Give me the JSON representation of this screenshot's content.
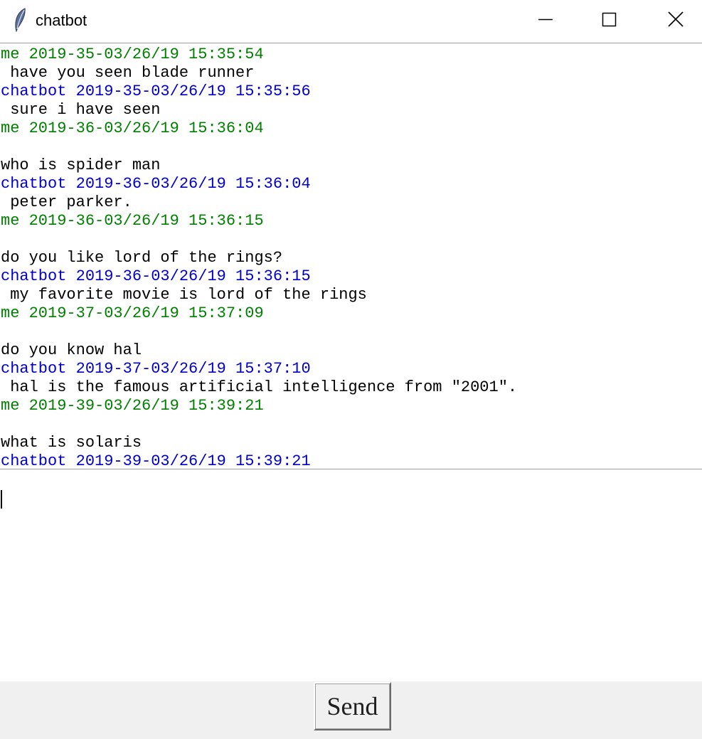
{
  "window": {
    "title": "chatbot",
    "app_icon": "feather-icon",
    "controls": {
      "minimize": "minimize-icon",
      "maximize": "maximize-icon",
      "close": "close-icon"
    }
  },
  "colors": {
    "me": "#008000",
    "chatbot": "#0000cc",
    "text": "#000000",
    "bottom_bar": "#f0f0f0"
  },
  "chat_log": [
    {
      "kind": "me",
      "text": "me 2019-35-03/26/19 15:35:54"
    },
    {
      "kind": "text",
      "text": " have you seen blade runner"
    },
    {
      "kind": "bot",
      "text": "chatbot 2019-35-03/26/19 15:35:56"
    },
    {
      "kind": "text",
      "text": " sure i have seen"
    },
    {
      "kind": "me",
      "text": "me 2019-36-03/26/19 15:36:04"
    },
    {
      "kind": "text",
      "text": ""
    },
    {
      "kind": "text",
      "text": "who is spider man"
    },
    {
      "kind": "bot",
      "text": "chatbot 2019-36-03/26/19 15:36:04"
    },
    {
      "kind": "text",
      "text": " peter parker."
    },
    {
      "kind": "me",
      "text": "me 2019-36-03/26/19 15:36:15"
    },
    {
      "kind": "text",
      "text": ""
    },
    {
      "kind": "text",
      "text": "do you like lord of the rings?"
    },
    {
      "kind": "bot",
      "text": "chatbot 2019-36-03/26/19 15:36:15"
    },
    {
      "kind": "text",
      "text": " my favorite movie is lord of the rings"
    },
    {
      "kind": "me",
      "text": "me 2019-37-03/26/19 15:37:09"
    },
    {
      "kind": "text",
      "text": ""
    },
    {
      "kind": "text",
      "text": "do you know hal"
    },
    {
      "kind": "bot",
      "text": "chatbot 2019-37-03/26/19 15:37:10"
    },
    {
      "kind": "text",
      "text": " hal is the famous artificial intelligence from \"2001\"."
    },
    {
      "kind": "me",
      "text": "me 2019-39-03/26/19 15:39:21"
    },
    {
      "kind": "text",
      "text": ""
    },
    {
      "kind": "text",
      "text": "what is solaris"
    },
    {
      "kind": "bot",
      "text": "chatbot 2019-39-03/26/19 15:39:21"
    }
  ],
  "input": {
    "value": ""
  },
  "send_button": {
    "label": "Send"
  }
}
